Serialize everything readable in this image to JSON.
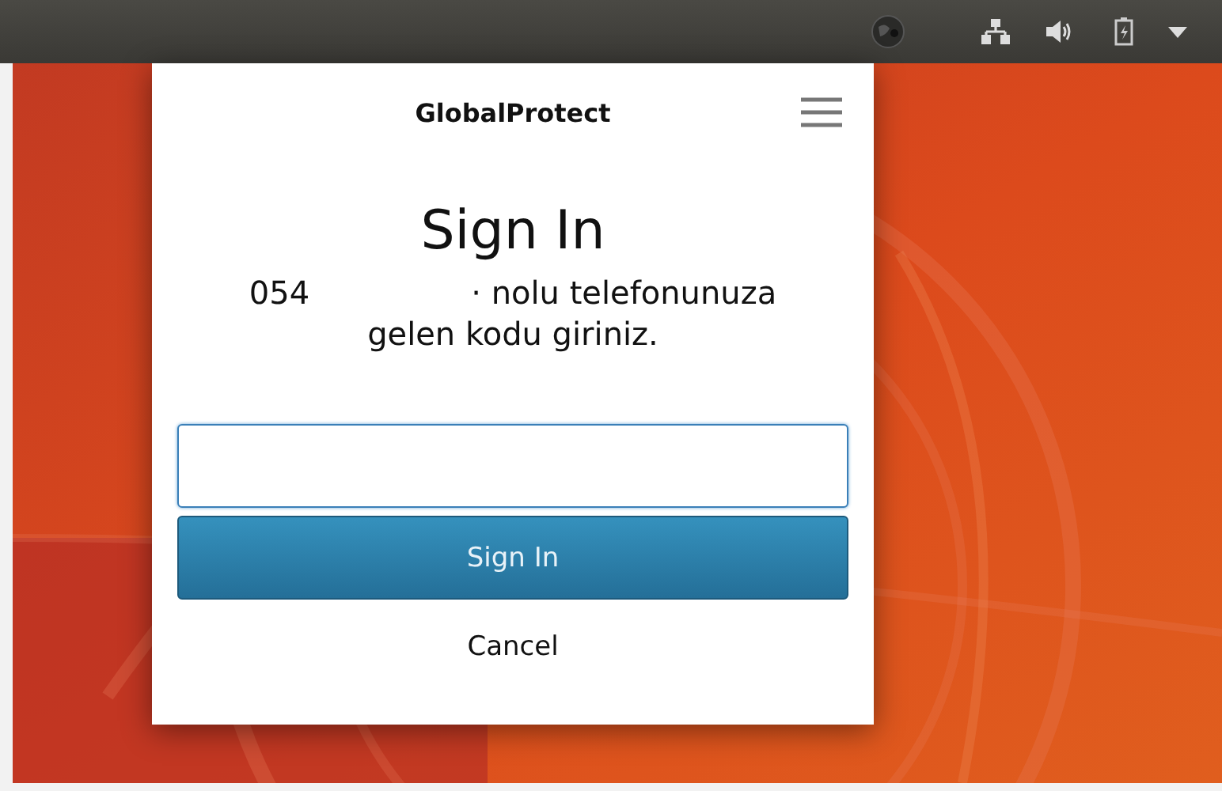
{
  "dialog": {
    "title": "GlobalProtect",
    "heading": "Sign In",
    "message": {
      "prefix": "054",
      "suffix": "· nolu telefonunuza",
      "line2": "gelen kodu giriniz."
    },
    "code_field": {
      "focused": true
    },
    "buttons": [
      {
        "kind": "primary",
        "label": "Sign In"
      },
      {
        "kind": "link",
        "label": "Cancel"
      }
    ]
  }
}
